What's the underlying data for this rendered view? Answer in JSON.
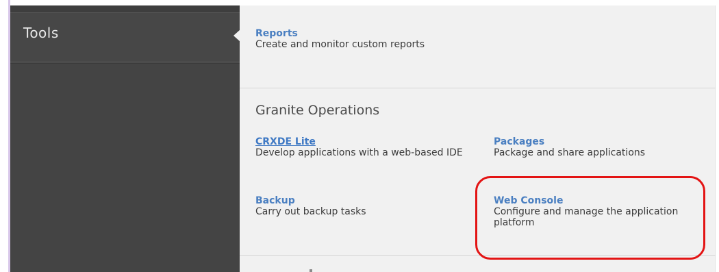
{
  "sidebar": {
    "items": [
      {
        "label": "Tools"
      }
    ]
  },
  "main": {
    "top_tools": [
      {
        "title": "Reports",
        "description": "Create and monitor custom reports"
      }
    ],
    "sections": [
      {
        "title": "Granite Operations",
        "tools": [
          {
            "title": "CRXDE Lite",
            "description": "Develop applications with a web-based IDE"
          },
          {
            "title": "Packages",
            "description": "Package and share applications"
          },
          {
            "title": "Backup",
            "description": "Carry out backup tasks"
          },
          {
            "title": "Web Console",
            "description": "Configure and manage the application platform"
          }
        ]
      }
    ]
  },
  "colors": {
    "sidebar_bg": "#474747",
    "main_bg": "#f1f1f1",
    "link": "#4a7fc1",
    "highlight": "#e31414"
  }
}
